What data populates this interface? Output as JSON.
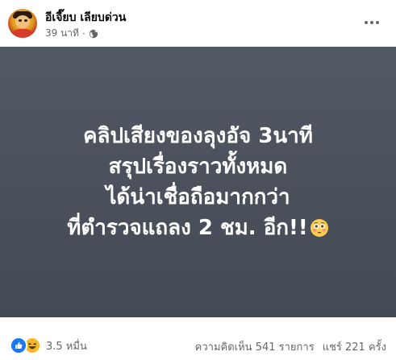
{
  "post": {
    "page_name": "อีเจี๊ยบ เลียบด่วน",
    "timestamp": "39 นาที",
    "separator": "·",
    "privacy_icon": "globe-icon",
    "more_icon": "more-horizontal-icon"
  },
  "card": {
    "background_color": "#4b515b",
    "text_color": "#ffffff",
    "lines": [
      "คลิปเสียงของลุงอัจ 3นาที",
      "สรุปเรื่องราวทั้งหมด",
      "ได้น่าเชื่อถือมากกว่า",
      "ที่ตำรวจแถลง 2 ชม. อีก!!"
    ],
    "emoji": "flushed-face-icon"
  },
  "footer": {
    "reaction_icons": [
      "like-icon",
      "haha-icon"
    ],
    "reaction_count": "3.5 หมื่น",
    "comments": "ความคิดเห็น 541 รายการ",
    "shares": "แชร์ 221 ครั้ง"
  }
}
